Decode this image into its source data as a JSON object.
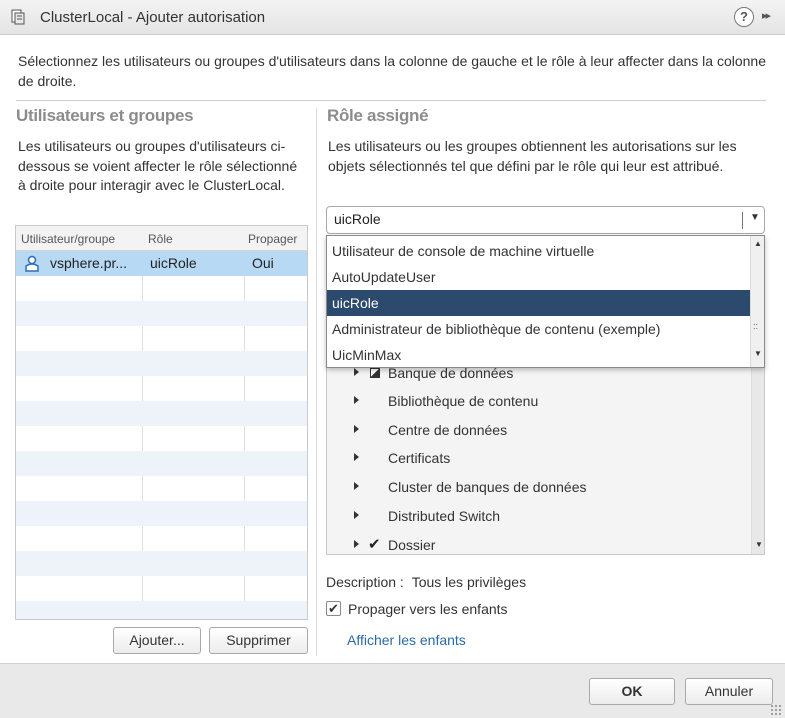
{
  "dialog": {
    "title": "ClusterLocal - Ajouter autorisation",
    "help_label": "?",
    "expand_label": "▸▸"
  },
  "intro": "Sélectionnez les utilisateurs ou groupes d'utilisateurs dans la colonne de gauche et le rôle à leur affecter dans la colonne de droite.",
  "left": {
    "title": "Utilisateurs et groupes",
    "description": "Les utilisateurs ou groupes d'utilisateurs ci-dessous se voient affecter le rôle sélectionné à droite pour interagir avec le ClusterLocal.",
    "columns": [
      "Utilisateur/groupe",
      "Rôle",
      "Propager"
    ],
    "rows": [
      {
        "user": "vsphere.pr...",
        "role": "uicRole",
        "propagate": "Oui"
      }
    ],
    "add_button": "Ajouter...",
    "remove_button": "Supprimer"
  },
  "right": {
    "title": "Rôle assigné",
    "description": "Les utilisateurs ou les groupes obtiennent les autorisations sur les objets sélectionnés tel que défini par le rôle qui leur est attribué.",
    "role_select": {
      "value": "uicRole",
      "options": [
        "Utilisateur de console de machine virtuelle",
        "AutoUpdateUser",
        "uicRole",
        "Administrateur de bibliothèque de contenu (exemple)",
        "UicMinMax"
      ],
      "selected_index": 2
    },
    "privileges": [
      {
        "label": "Banque de données",
        "state": "partial"
      },
      {
        "label": "Bibliothèque de contenu",
        "state": "none"
      },
      {
        "label": "Centre de données",
        "state": "none"
      },
      {
        "label": "Certificats",
        "state": "none"
      },
      {
        "label": "Cluster de banques de données",
        "state": "none"
      },
      {
        "label": "Distributed Switch",
        "state": "none"
      },
      {
        "label": "Dossier",
        "state": "checked"
      }
    ],
    "description_label": "Description :",
    "description_value": "Tous les privilèges",
    "propagate_label": "Propager vers les enfants",
    "propagate_checked": true,
    "show_children_link": "Afficher les enfants"
  },
  "footer": {
    "ok_label": "OK",
    "cancel_label": "Annuler"
  }
}
